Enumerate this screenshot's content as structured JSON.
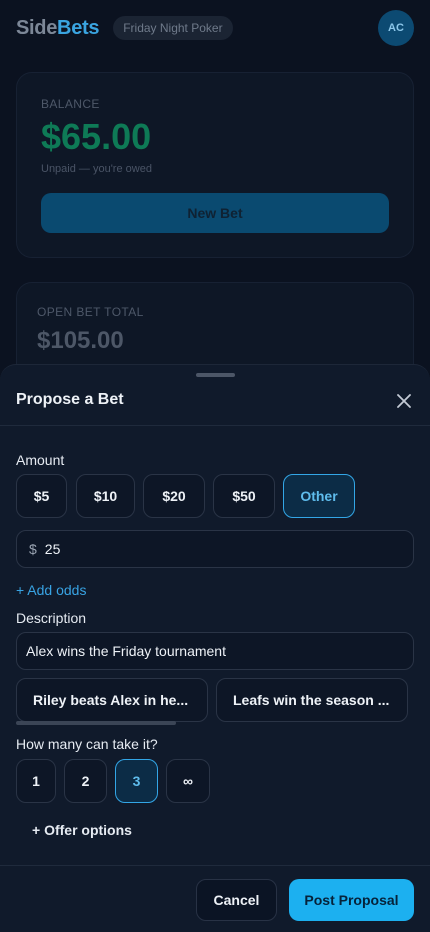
{
  "header": {
    "logo_left": "Side",
    "logo_right": "Bets",
    "group_name": "Friday Night Poker",
    "avatar_initials": "AC"
  },
  "balance_card": {
    "label": "BALANCE",
    "amount": "$65.00",
    "subtext": "Unpaid — you're owed",
    "new_bet_label": "New Bet"
  },
  "open_card": {
    "label": "OPEN BET TOTAL",
    "amount": "$105.00"
  },
  "sheet": {
    "title": "Propose a Bet",
    "amount_label": "Amount",
    "amount_options": [
      "$5",
      "$10",
      "$20",
      "$50",
      "Other"
    ],
    "amount_selected": "Other",
    "currency_symbol": "$",
    "amount_value": "25",
    "add_odds_label": "+ Add odds",
    "description_label": "Description",
    "description_value": "Alex wins the Friday tournament",
    "suggestions": [
      "Riley beats Alex in he...",
      "Leafs win the season ..."
    ],
    "takers_label": "How many can take it?",
    "taker_options": [
      "1",
      "2",
      "3",
      "∞"
    ],
    "taker_selected": "3",
    "offer_options_label": "+ Offer options",
    "cancel_label": "Cancel",
    "post_label": "Post Proposal"
  },
  "colors": {
    "accent": "#1cb0f0",
    "selected_border": "#33a6e6",
    "balance_green": "#0e7a56"
  }
}
